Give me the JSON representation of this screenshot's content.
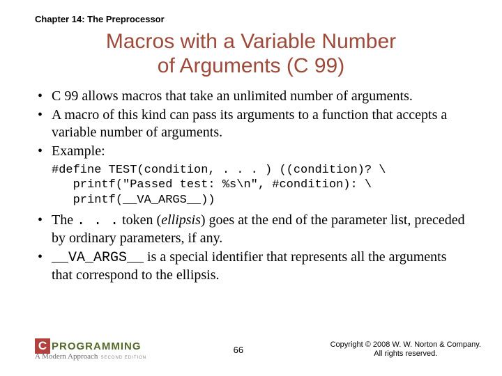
{
  "chapter": "Chapter 14: The Preprocessor",
  "title_line1": "Macros with a Variable Number",
  "title_line2": "of Arguments (C 99)",
  "bullets": {
    "b1": "C 99 allows macros that take an unlimited number of arguments.",
    "b2": "A macro of this kind can pass its arguments to a function that accepts a variable number of arguments.",
    "b3": "Example:",
    "b4_pre": "The ",
    "b4_token": ". . .",
    "b4_mid": " token (",
    "b4_ital": "ellipsis",
    "b4_post": ") goes at the end of the parameter list, preceded by ordinary parameters, if any.",
    "b5_token": "__VA_ARGS__",
    "b5_post": " is a special identifier that represents all the arguments that correspond to the ellipsis."
  },
  "code": "#define TEST(condition, . . . ) ((condition)? \\\n   printf(\"Passed test: %s\\n\", #condition): \\\n   printf(__VA_ARGS__))",
  "footer": {
    "logo_c": "C",
    "logo_text": "PROGRAMMING",
    "logo_sub": "A Modern Approach",
    "logo_ed": "SECOND EDITION",
    "page": "66",
    "copy_line1": "Copyright © 2008 W. W. Norton & Company.",
    "copy_line2": "All rights reserved."
  }
}
